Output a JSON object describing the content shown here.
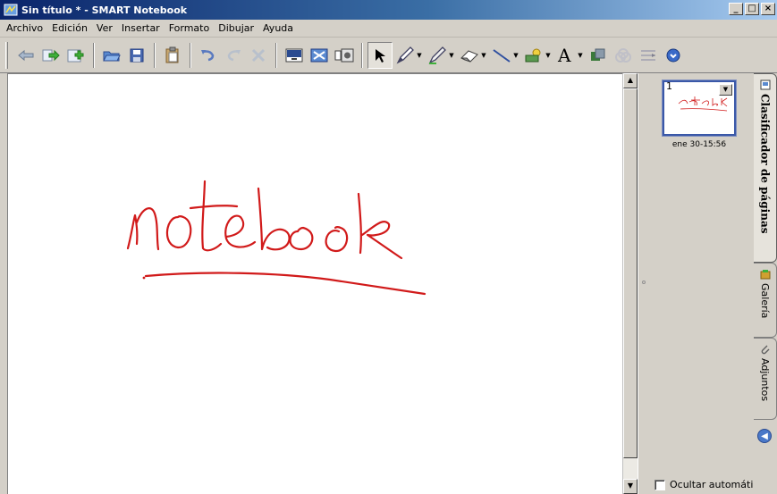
{
  "window": {
    "title": "Sin título * - SMART Notebook",
    "buttons": {
      "minimize": "_",
      "maximize": "□",
      "close": "×"
    }
  },
  "menu": [
    "Archivo",
    "Edición",
    "Ver",
    "Insertar",
    "Formato",
    "Dibujar",
    "Ayuda"
  ],
  "toolbar": {
    "buttons": [
      "back-arrow-icon",
      "forward-arrow-icon",
      "add-page-icon",
      "open-folder-icon",
      "save-icon",
      "paste-icon",
      "undo-icon",
      "redo-icon",
      "delete-icon",
      "screen-shade-icon",
      "full-screen-icon",
      "capture-icon",
      "select-arrow-icon",
      "pen-icon",
      "creative-pen-icon",
      "eraser-icon",
      "line-icon",
      "shape-icon",
      "text-icon",
      "properties-icon",
      "table-icon",
      "toolbar-move-icon",
      "more-icon"
    ],
    "active_tool": "select-arrow-icon"
  },
  "canvas": {
    "ink_text": "notebook",
    "ink_color": "#d11a1a"
  },
  "page_sorter": {
    "thumbnail_number": "1",
    "thumbnail_caption": "ene 30-15:56",
    "autohide_label": "Ocultar automáticar",
    "autohide_checked": false
  },
  "tabs": {
    "sorter": "Clasificador de páginas",
    "gallery": "Galería",
    "attachments": "Adjuntos"
  },
  "colors": {
    "title_bar_start": "#0a246a",
    "title_bar_end": "#a6caf0",
    "chrome": "#d4d0c8",
    "ink": "#d11a1a",
    "thumb_border": "#3a58a8"
  }
}
